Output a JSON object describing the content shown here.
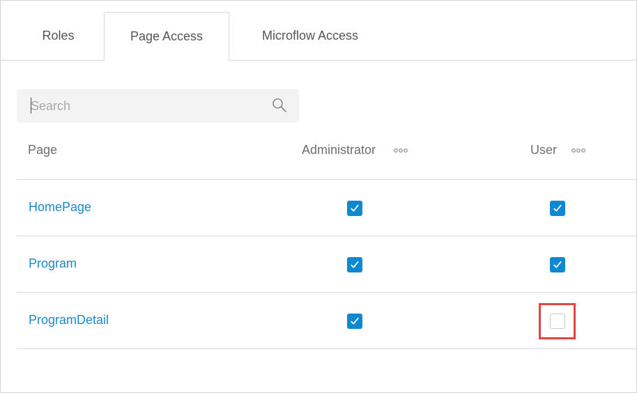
{
  "tabs": [
    {
      "label": "Roles",
      "active": false
    },
    {
      "label": "Page Access",
      "active": true
    },
    {
      "label": "Microflow Access",
      "active": false
    }
  ],
  "search": {
    "placeholder": "Search",
    "value": "",
    "icon": "search-icon"
  },
  "table": {
    "headers": {
      "page": "Page",
      "roles": [
        "Administrator",
        "User"
      ],
      "more_icon": "more-options-icon"
    },
    "rows": [
      {
        "page": "HomePage",
        "administrator": true,
        "user": true
      },
      {
        "page": "Program",
        "administrator": true,
        "user": true
      },
      {
        "page": "ProgramDetail",
        "administrator": true,
        "user": false
      }
    ]
  },
  "colors": {
    "accent": "#0f88d2",
    "link": "#1a88c9",
    "highlight": "#e04444"
  }
}
